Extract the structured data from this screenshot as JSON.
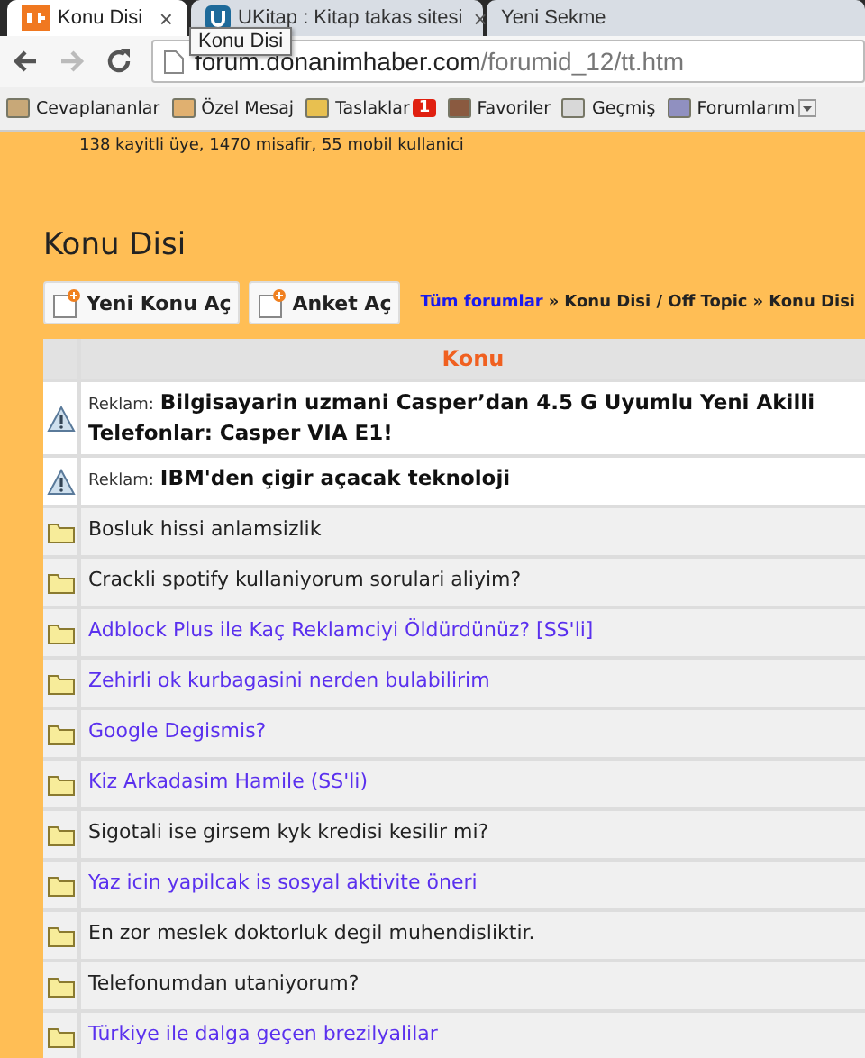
{
  "tabs": [
    {
      "label": "Konu Disi",
      "selected": true,
      "close": "×"
    },
    {
      "label": "UKitap : Kitap takas sitesi",
      "selected": false,
      "close": "×"
    },
    {
      "label": "Yeni Sekme",
      "selected": false
    }
  ],
  "tooltip": "Konu Disi",
  "address": {
    "host": "forum.donanimhaber.com",
    "path": "/forumid_12/tt.htm"
  },
  "bookmarks": [
    {
      "label": "Cevaplananlar"
    },
    {
      "label": "Özel Mesaj"
    },
    {
      "label": "Taslaklar",
      "badge": "1"
    },
    {
      "label": "Favoriler"
    },
    {
      "label": "Geçmiş"
    },
    {
      "label": "Forumlarım"
    }
  ],
  "stats": "138 kayitli üye, 1470 misafir, 55 mobil kullanici",
  "page_title": "Konu Disi",
  "buttons": [
    "Yeni Konu Aç",
    "Anket Aç"
  ],
  "breadcrumb": [
    {
      "kind": "link",
      "label": "Tüm forumlar"
    },
    {
      "kind": "sep",
      "label": "»"
    },
    {
      "kind": "text",
      "label": "Konu Disi / Off Topic"
    },
    {
      "kind": "sep",
      "label": "»"
    },
    {
      "kind": "text",
      "label": "Konu Disi"
    }
  ],
  "table": {
    "column": "Konu",
    "rows": [
      {
        "kind": "ad",
        "prefix": "Reklam:",
        "title": "Bilgisayarin uzmani Casper’dan 4.5 G Uyumlu Yeni Akilli Telefonlar: Casper VIA E1!"
      },
      {
        "kind": "ad",
        "prefix": "Reklam:",
        "title": "IBM'den çigir açacak teknoloji"
      },
      {
        "kind": "topic",
        "title": "Bosluk hissi anlamsizlik",
        "visited": false
      },
      {
        "kind": "topic",
        "title": "Crackli spotify kullaniyorum sorulari aliyim?",
        "visited": false
      },
      {
        "kind": "topic",
        "title": "Adblock Plus ile Kaç Reklamciyi Öldürdünüz? [SS'li]",
        "visited": true
      },
      {
        "kind": "topic",
        "title": "Zehirli ok kurbagasini nerden bulabilirim",
        "visited": true
      },
      {
        "kind": "topic",
        "title": "Google Degismis?",
        "visited": true
      },
      {
        "kind": "topic",
        "title": "Kiz Arkadasim Hamile (SS'li)",
        "visited": true
      },
      {
        "kind": "topic",
        "title": "Sigotali ise girsem kyk kredisi kesilir mi?",
        "visited": false
      },
      {
        "kind": "topic",
        "title": "Yaz icin yapilcak is sosyal aktivite öneri",
        "visited": true
      },
      {
        "kind": "topic",
        "title": "En zor meslek doktorluk degil muhendisliktir.",
        "visited": false
      },
      {
        "kind": "topic",
        "title": "Telefonumdan utaniyorum?",
        "visited": false
      },
      {
        "kind": "topic",
        "title": "Türkiye ile dalga geçen brezilyalilar",
        "visited": true
      }
    ]
  }
}
